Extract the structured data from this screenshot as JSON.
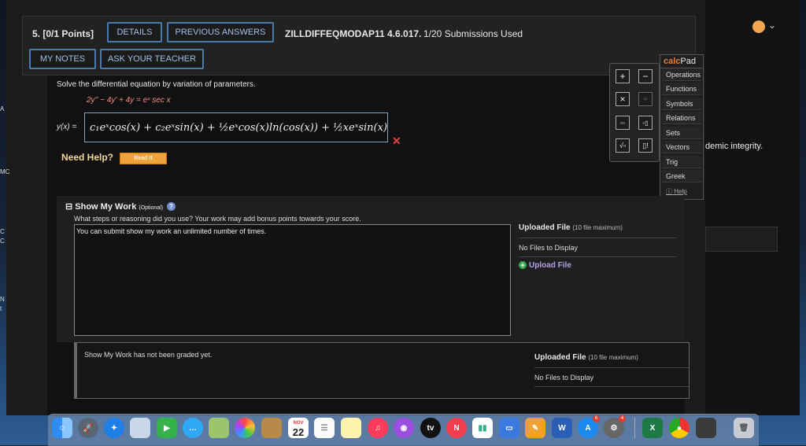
{
  "question": {
    "number": "5. [0/1 Points]",
    "details_label": "DETAILS",
    "previous_answers_label": "PREVIOUS ANSWERS",
    "code": "ZILLDIFFEQMODAP11 4.6.017.",
    "submissions": "1/20 Submissions Used",
    "my_notes_label": "MY NOTES",
    "ask_teacher_label": "ASK YOUR TEACHER"
  },
  "problem": {
    "instruction": "Solve the differential equation by variation of parameters.",
    "equation": "2y'' − 4y' + 4y = eˣ sec x",
    "answer_label": "y(x) =",
    "answer_value": "c₁eˣcos(x) + c₂eˣsin(x) + ½eˣcos(x)ln(cos(x)) + ½xeˣsin(x)",
    "need_help": "Need Help?",
    "read_it": "Read It"
  },
  "calcpad": {
    "title_bold": "calc",
    "title_rest": "Pad",
    "menu": [
      "Operations",
      "Functions",
      "Symbols",
      "Relations",
      "Sets",
      "Vectors",
      "Trig",
      "Greek"
    ],
    "help": "Help",
    "buttons": [
      "+",
      "−",
      "×",
      "÷",
      "▫▫",
      "▫▯",
      "√▫",
      "▯!"
    ]
  },
  "background_text": "demic integrity.",
  "show_work": {
    "title": "Show My Work",
    "optional": "(Optional)",
    "question": "What steps or reasoning did you use? Your work may add bonus points towards your score.",
    "box_text": "You can submit show my work an unlimited number of times.",
    "uploaded_file": "Uploaded File",
    "max": "(10 file maximum)",
    "no_files": "No Files to Display",
    "upload_file": "Upload File",
    "graded_text": "Show My Work has not been graded yet.",
    "uploaded_file2": "Uploaded File",
    "max2": "(10 file maximum)",
    "no_files2": "No Files to Display"
  },
  "dock": {
    "calendar_month": "NOV",
    "calendar_day": "22",
    "tv_label": "tv",
    "badge_a": "6",
    "badge_b": "4"
  },
  "colors": {
    "link_blue": "#9fc1ea",
    "button_border": "#4a7bb0",
    "wrong_red": "#e0483c",
    "calc_orange": "#e67f3a",
    "read_it": "#f0a23c"
  }
}
